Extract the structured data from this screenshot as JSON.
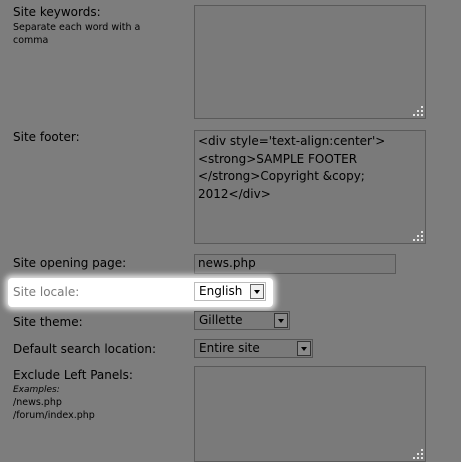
{
  "keywords": {
    "label": "Site keywords:",
    "hint": "Separate each word with a comma",
    "value": ""
  },
  "footer": {
    "label": "Site footer:",
    "value": "<div style='text-align:center'>\n<strong>SAMPLE FOOTER\n</strong>Copyright &copy;\n2012</div>"
  },
  "opening_page": {
    "label": "Site opening page:",
    "value": "news.php"
  },
  "locale": {
    "label": "Site locale:",
    "value": "English"
  },
  "theme": {
    "label": "Site theme:",
    "value": "Gillette"
  },
  "search_location": {
    "label": "Default search location:",
    "value": "Entire site"
  },
  "exclude_left": {
    "label": "Exclude Left Panels:",
    "examples_label": "Examples:",
    "example_1": "/news.php",
    "example_2": "/forum/index.php",
    "value": ""
  },
  "colors": {
    "background": "#7d7d7d",
    "highlight": "#ffffff"
  }
}
